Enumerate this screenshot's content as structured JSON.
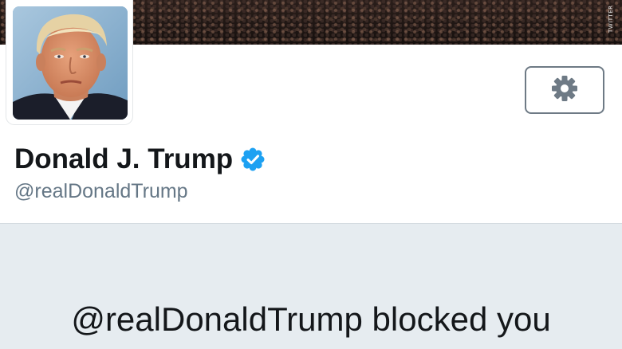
{
  "watermark": "TWITTER",
  "profile": {
    "name": "Donald J. Trump",
    "handle": "@realDonaldTrump",
    "verified": true,
    "avatar_icon": "profile-photo"
  },
  "settings": {
    "icon": "gear-icon"
  },
  "blocked_notice": {
    "text": "@realDonaldTrump blocked you"
  },
  "colors": {
    "verified_badge": "#1da1f2",
    "handle_text": "#657786",
    "panel_background": "#e6ecf0",
    "button_border": "#6e7a85"
  }
}
